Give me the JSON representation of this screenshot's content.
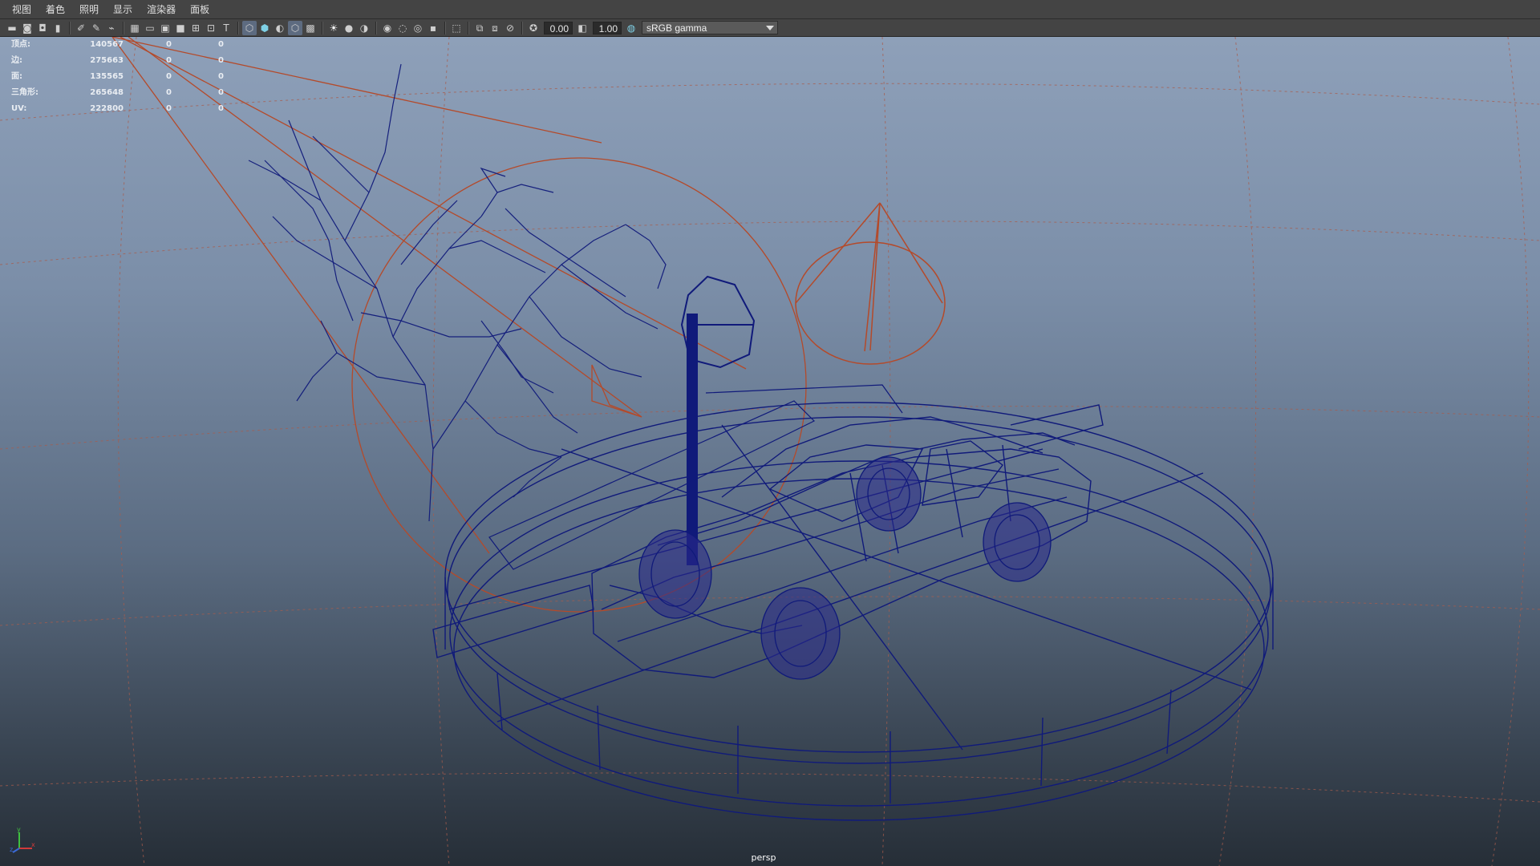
{
  "menu": {
    "items": [
      {
        "label": "视图"
      },
      {
        "label": "着色"
      },
      {
        "label": "照明"
      },
      {
        "label": "显示"
      },
      {
        "label": "渲染器"
      },
      {
        "label": "面板"
      }
    ]
  },
  "toolbar": {
    "exposure_value": "0.00",
    "gamma_value": "1.00",
    "colorspace": "sRGB gamma",
    "icons": [
      "select-camera-icon",
      "camera-attributes-icon",
      "bookmarks-icon",
      "image-plane-icon",
      "grid-toggle-icon",
      "film-gate-icon",
      "resolution-gate-icon",
      "gate-mask-icon",
      "field-chart-icon",
      "safe-action-icon",
      "safe-title-icon",
      "wireframe-icon",
      "smooth-shade-icon",
      "default-material-icon",
      "xray-icon",
      "use-all-lights-icon",
      "shadows-icon",
      "screen-space-ao-icon",
      "motion-blur-icon",
      "multisample-aa-icon",
      "depth-of-field-icon",
      "isolate-select-icon",
      "xray-joints-icon",
      "xray-active-icon",
      "backface-culling-icon"
    ]
  },
  "hud": {
    "rows": [
      {
        "label": "顶点:",
        "value": "140567",
        "selected": "0",
        "components": "0"
      },
      {
        "label": "边:",
        "value": "275663",
        "selected": "0",
        "components": "0"
      },
      {
        "label": "面:",
        "value": "135565",
        "selected": "0",
        "components": "0"
      },
      {
        "label": "三角形:",
        "value": "265648",
        "selected": "0",
        "components": "0"
      },
      {
        "label": "UV:",
        "value": "222800",
        "selected": "0",
        "components": "0"
      }
    ]
  },
  "viewport": {
    "camera": "persp",
    "wire_color": "#101a7a",
    "light_color": "#b44a2a",
    "grid_color": "#a85c4c",
    "axes": {
      "x": "x",
      "y": "y",
      "z": "z"
    },
    "colors": {
      "x_axis": "#d23a3a",
      "y_axis": "#40c040",
      "z_axis": "#3a6ad8"
    }
  }
}
